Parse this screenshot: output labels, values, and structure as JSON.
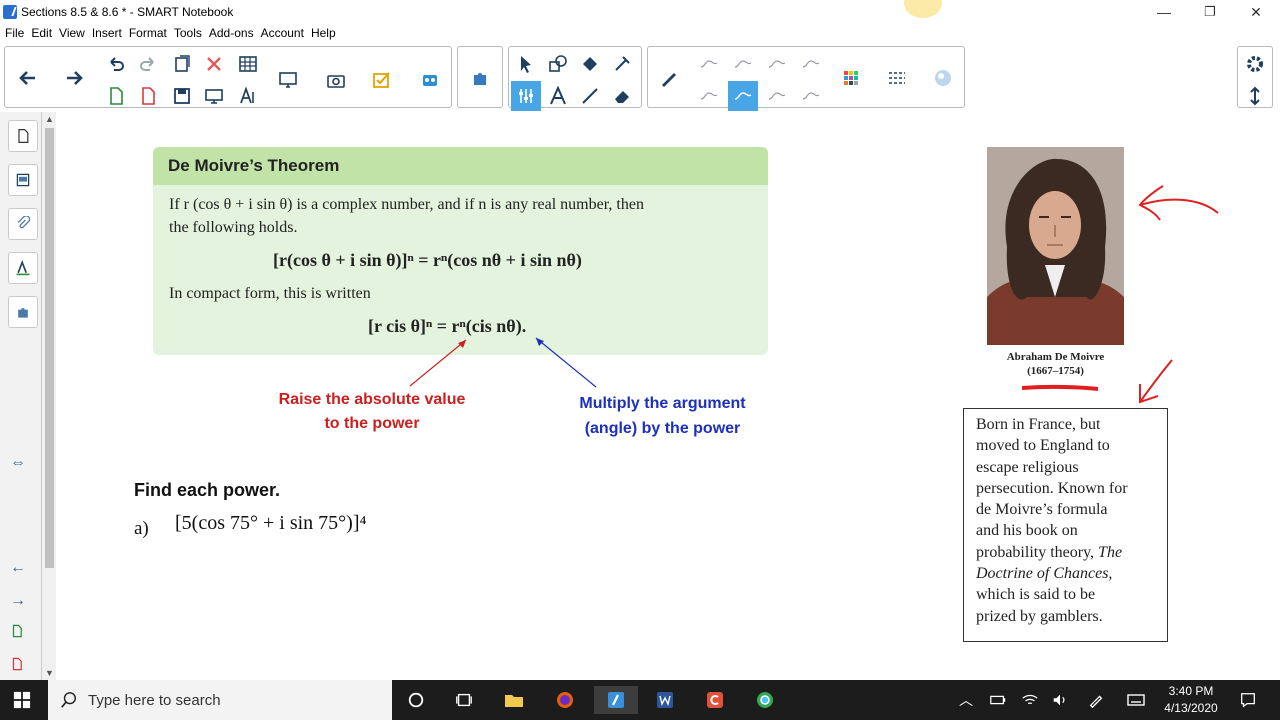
{
  "window": {
    "title": "Sections 8.5 & 8.6 * - SMART Notebook",
    "minimize": "—",
    "restore": "❐",
    "close": "✕"
  },
  "menu": [
    "File",
    "Edit",
    "View",
    "Insert",
    "Format",
    "Tools",
    "Add-ons",
    "Account",
    "Help"
  ],
  "theorem": {
    "heading": "De Moivre’s Theorem",
    "line1": "If r (cos θ + i sin θ) is a complex number, and if n is any real number, then",
    "line2": "the following holds.",
    "formula1": "[r(cos θ + i sin θ)]ⁿ = rⁿ(cos nθ + i sin nθ)",
    "compact_label": "In compact form, this is written",
    "formula2": "[r cis θ]ⁿ = rⁿ(cis nθ)."
  },
  "annotations": {
    "red_line1": "Raise the absolute value",
    "red_line2": "to the power",
    "blue_line1": "Multiply the argument",
    "blue_line2": "(angle) by the power"
  },
  "exercise": {
    "heading": "Find each power.",
    "label": "a)",
    "expression": "[5(cos 75° + i sin 75°)]⁴"
  },
  "portrait": {
    "name": "Abraham De Moivre",
    "years": "(1667–1754)"
  },
  "bio": {
    "lines": [
      "Born in France, but",
      "moved to England to",
      "escape religious",
      "persecution.  Known for",
      "de Moivre’s formula",
      "and his book on",
      "probability theory, "
    ],
    "italic1": "The",
    "italic2": "Doctrine of Chances",
    "after_italic": ",",
    "rest": [
      "which is said to be",
      "prized by gamblers."
    ]
  },
  "taskbar": {
    "search_placeholder": "Type here to search",
    "time": "3:40 PM",
    "date": "4/13/2020"
  },
  "colors": {
    "accent": "#49a6e6",
    "theorem_bg": "#e3f3dd",
    "theorem_head": "#c2e3a8",
    "annotation_red": "#cc1f1f",
    "annotation_blue": "#1d2fbf"
  }
}
